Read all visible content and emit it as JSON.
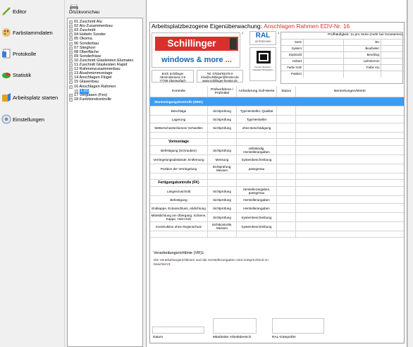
{
  "nav": {
    "items": [
      {
        "label": "Editor",
        "icon": "pencil-icon"
      },
      {
        "label": "Farbstammdaten",
        "icon": "palette-icon"
      },
      {
        "label": "Protokolle",
        "icon": "protocol-icon"
      },
      {
        "label": "Statistik",
        "icon": "chart-icon"
      },
      {
        "label": "Arbeitsplatz starten",
        "icon": "workplace-icon"
      },
      {
        "label": "Einstellungen",
        "icon": "settings-icon"
      }
    ]
  },
  "toolbar": {
    "print_label": "Druckvorschau"
  },
  "tree": {
    "nodes": [
      "01 Zuschnitt Alu",
      "02 Alu-Zusammenbau",
      "03 Zuschnitt",
      "04 Hobeln Sonder",
      "05 Okoma",
      "06 Sonderbau",
      "07 Stieghorr",
      "08 Oberfläche",
      "09 Sonderfräse",
      "10 Zuschnitt Glasleisten Elumatec",
      "11 Zuschnitt Glasleisten Rapid",
      "12 Rahmenzusammenbau",
      "13 Aluahmenmontage",
      "14 Anschlagen Flügel",
      "15 Glasenbau",
      "16 Anschlagen Rahmen"
    ],
    "child": "1.90",
    "after": [
      "17 Verglasen (Fex)",
      "18 Funktionskontrolle"
    ]
  },
  "doc": {
    "title_prefix": "Arbeitsplatzbezogene Eigenüberwachung:",
    "title_red": "Anschlagen Rahmen EDV-Nr. 16",
    "logo_top": "Schillinger",
    "logo_bottom": "windows & more",
    "logo_bottom_dots": "...",
    "ral": "RAL",
    "ral_sub": "GÜTEZEICHEN",
    "ral_caption": "Fenster Haustüren Fassaden Wintergärten",
    "addr1": [
      "Erich Schillinger",
      "Allmendstrasse 3-5",
      "77709 Oberwolfach"
    ],
    "addr2": [
      "Tel. 07834/93479-0",
      "info@schillinger@fenster.de",
      "www.schillinger-fenster.de"
    ],
    "marker": "1",
    "pruef": {
      "title": "Prüfhäufigkeit: 1x pro Serie (mehr bei Grosserien)",
      "rows": [
        {
          "l1": "Serie:",
          "l2": "BV:"
        },
        {
          "l1": "System:",
          "l2": "Bearbeiter:"
        },
        {
          "l1": "Stückzahl:",
          "l2": "Beschlag:"
        },
        {
          "l1": "Holzart:",
          "l2": "Liefertermin:"
        },
        {
          "l1": "Farbe Holz:",
          "l2": "Farbe Alu:"
        },
        {
          "l1": "Position:",
          "l2": ""
        }
      ]
    },
    "table": {
      "headers": [
        "Kontrolle",
        "Prüfverfahren / Prüfmittel",
        "Anforderung Soll-Werte",
        "Status",
        "Bemerkungen/Werte"
      ],
      "rows": [
        {
          "type": "blue",
          "c1": "Wareneingangskontrolle (WEK)",
          "c2": "",
          "c3": ""
        },
        {
          "type": "row",
          "c1": "Beschläge",
          "c2": "Sichtprüfung",
          "c3": "Typ/Hersteller, Qualität"
        },
        {
          "type": "row",
          "c1": "Lagerung",
          "c2": "Sichtprüfung",
          "c3": "Typ/Hersteller"
        },
        {
          "type": "row",
          "c1": "Wetterschutzschienen/ Schwellen",
          "c2": "Sichtprüfung",
          "c3": "ohne Beschädigung"
        },
        {
          "type": "empty",
          "c1": "",
          "c2": "",
          "c3": ""
        },
        {
          "type": "sect",
          "c1": "Vormontage",
          "c2": "",
          "c3": ""
        },
        {
          "type": "row",
          "c1": "Befestigung (Schrauben)",
          "c2": "Sichtprüfung",
          "c3": "vollständig, Herstellerangaben"
        },
        {
          "type": "row",
          "c1": "Verriegelungsabstände, Entfernung",
          "c2": "Messung",
          "c3": "Systembeschreibung"
        },
        {
          "type": "row",
          "c1": "Position der Verriegelung",
          "c2": "Sichtprüfung, Messen",
          "c3": "passgenau"
        },
        {
          "type": "empty",
          "c1": "",
          "c2": "",
          "c3": ""
        },
        {
          "type": "sect",
          "c1": "Fertigungskontrolle (FK)",
          "c2": "",
          "c3": ""
        },
        {
          "type": "row",
          "c1": "Längenzuschnitt",
          "c2": "Sichtprüfung",
          "c3": "Herstellerangaben, passgenau"
        },
        {
          "type": "row",
          "c1": "Befestigung",
          "c2": "Sichtprüfung",
          "c3": "Herstellerangaben"
        },
        {
          "type": "row",
          "c1": "Endkappe, Eckanschluss, Abdichtung",
          "c2": "Sichtprüfung",
          "c3": "Herstellerangaben"
        },
        {
          "type": "row",
          "c1": "Mitteldichtung am Übergang, Schiene, Kappe, Holz-Holz",
          "c2": "Sichtprüfung",
          "c3": "Systembeschreibung"
        },
        {
          "type": "row",
          "c1": "Konstruktion ohne Regenschutz",
          "c2": "Sichtkontrolle, Messen",
          "c3": "Systembeschreibung"
        },
        {
          "type": "empty",
          "c1": "",
          "c2": "",
          "c3": ""
        }
      ]
    },
    "vr": {
      "title": "Verarbeitungsrichtlinie (VR)",
      "text": "Die Verarbeitungsrichtlinien und die Herstellerangaben sind entsprechend zu beachten!"
    },
    "sig": {
      "date": "Datum",
      "worker": "Mitarbeiter Arbeitsbereich",
      "ral": "RAL-Güteprüfer"
    }
  },
  "colors": {
    "accent_blue": "#3a9df5",
    "brand_red": "#d9302c",
    "brand_blue": "#1a65b0"
  }
}
